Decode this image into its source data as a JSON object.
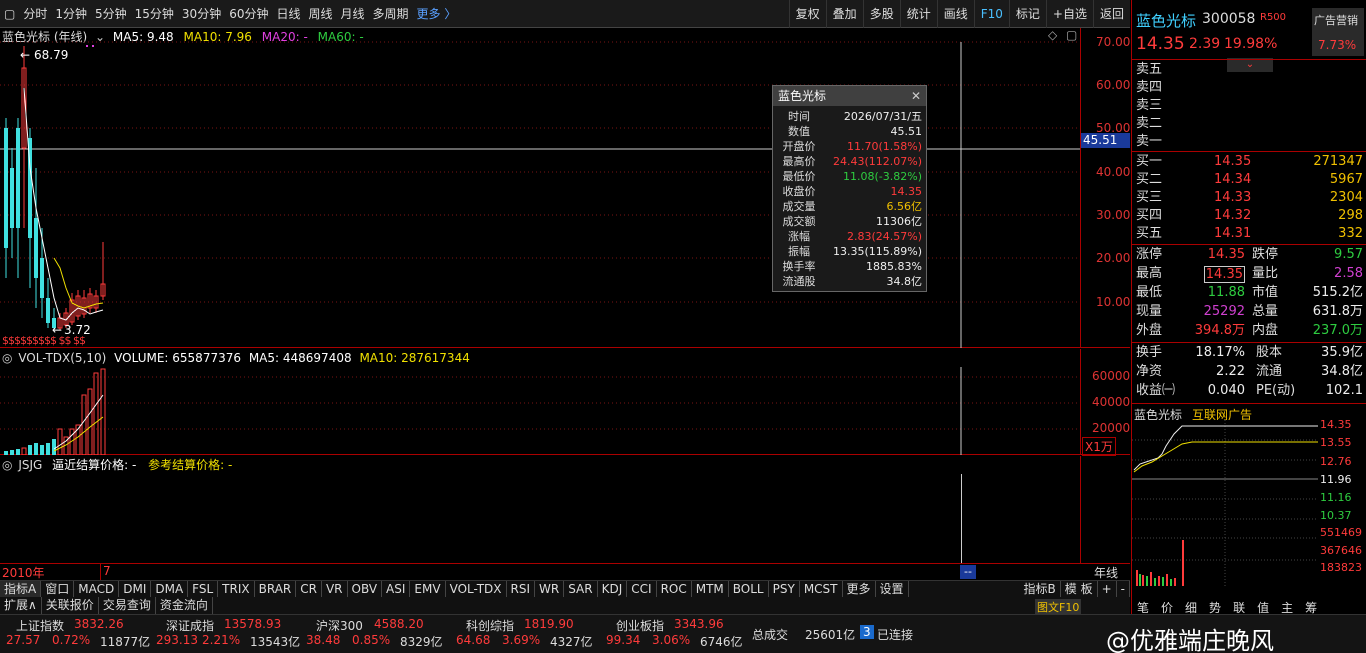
{
  "toolbar": {
    "periods": [
      "分时",
      "1分钟",
      "5分钟",
      "15分钟",
      "30分钟",
      "60分钟",
      "日线",
      "周线",
      "月线",
      "多周期"
    ],
    "more": "更多 〉",
    "right": [
      "复权",
      "叠加",
      "多股",
      "统计",
      "画线",
      "F10",
      "标记",
      "+自选",
      "返回"
    ]
  },
  "main": {
    "title": "蓝色光标 (年线)",
    "ma5": "MA5: 9.48",
    "ma10": "MA10: 7.96",
    "ma20": "MA20: -",
    "ma60": "MA60: -",
    "high_label": "68.79",
    "low_label": "3.72",
    "yticks": [
      "70.00",
      "60.00",
      "50.00",
      "40.00",
      "30.00",
      "20.00",
      "10.00"
    ],
    "cursor_value": "45.51",
    "dividend_marks": "$$$$$$$$$ $$ $$"
  },
  "tooltip": {
    "title": "蓝色光标",
    "close": "✕",
    "rows": [
      {
        "k": "时间",
        "v": "2026/07/31/五",
        "c": "white"
      },
      {
        "k": "数值",
        "v": "45.51",
        "c": "white"
      },
      {
        "k": "开盘价",
        "v": "11.70(1.58%)",
        "c": "red"
      },
      {
        "k": "最高价",
        "v": "24.43(112.07%)",
        "c": "red"
      },
      {
        "k": "最低价",
        "v": "11.08(-3.82%)",
        "c": "green"
      },
      {
        "k": "收盘价",
        "v": "14.35",
        "c": "red"
      },
      {
        "k": "成交量",
        "v": "6.56亿",
        "c": "yellow"
      },
      {
        "k": "成交额",
        "v": "11306亿",
        "c": "white"
      },
      {
        "k": "涨幅",
        "v": "2.83(24.57%)",
        "c": "red"
      },
      {
        "k": "振幅",
        "v": "13.35(115.89%)",
        "c": "white"
      },
      {
        "k": "换手率",
        "v": "1885.83%",
        "c": "white"
      },
      {
        "k": "流通股",
        "v": "34.8亿",
        "c": "white"
      }
    ]
  },
  "volume": {
    "label": "VOL-TDX(5,10)",
    "volume": "VOLUME: 655877376",
    "ma5": "MA5: 448697408",
    "ma10": "MA10: 287617344",
    "yticks": [
      "60000",
      "40000",
      "20000"
    ],
    "unit": "X1万"
  },
  "jsjg": {
    "label": "JSJG",
    "recent": "逼近结算价格: -",
    "ref": "参考结算价格: -"
  },
  "xaxis": {
    "start": "2010年",
    "mid": "7",
    "period": "年线",
    "cursor": "--"
  },
  "tabs": {
    "row1": [
      "指标A",
      "窗口",
      "MACD",
      "DMI",
      "DMA",
      "FSL",
      "TRIX",
      "BRAR",
      "CR",
      "VR",
      "OBV",
      "ASI",
      "EMV",
      "VOL-TDX",
      "RSI",
      "WR",
      "SAR",
      "KDJ",
      "CCI",
      "ROC",
      "MTM",
      "BOLL",
      "PSY",
      "MCST",
      "更多",
      "设置"
    ],
    "row1_right": [
      "指标B",
      "模 板",
      "+",
      "-"
    ],
    "row2": [
      "扩展∧",
      "关联报价",
      "交易查询",
      "资金流向"
    ]
  },
  "indices": [
    {
      "name": "上证指数",
      "val": "3832.26",
      "chg": "27.57",
      "pct": "0.72%",
      "amt": "11877亿"
    },
    {
      "name": "深证成指",
      "val": "13578.93",
      "chg": "293.13",
      "pct": "2.21%",
      "amt": "13543亿"
    },
    {
      "name": "沪深300",
      "val": "4588.20",
      "chg": "38.48",
      "pct": "0.85%",
      "amt": "8329亿"
    },
    {
      "name": "科创综指",
      "val": "1819.90",
      "chg": "64.68",
      "pct": "3.69%",
      "amt": "4327亿"
    },
    {
      "name": "创业板指",
      "val": "3343.96",
      "chg": "99.34",
      "pct": "3.06%",
      "amt": "6746亿"
    }
  ],
  "bottom": {
    "total_label": "总成交",
    "total": "25601亿",
    "conn_num": "3",
    "conn": "已连接",
    "f10": "图文F10",
    "watermark": "@优雅端庄晚风",
    "right_tabs": [
      "笔",
      "价",
      "细",
      "势",
      "联",
      "值",
      "主",
      "筹"
    ]
  },
  "stock": {
    "name": "蓝色光标",
    "code": "300058",
    "tag": "R500",
    "ad": "广告营销",
    "ad_pct": "7.73%",
    "price": "14.35",
    "chg": "2.39",
    "pct": "19.98%",
    "sells": [
      "卖五",
      "卖四",
      "卖三",
      "卖二",
      "卖一"
    ],
    "buys": [
      {
        "k": "买一",
        "p": "14.35",
        "v": "271347"
      },
      {
        "k": "买二",
        "p": "14.34",
        "v": "5967"
      },
      {
        "k": "买三",
        "p": "14.33",
        "v": "2304"
      },
      {
        "k": "买四",
        "p": "14.32",
        "v": "298"
      },
      {
        "k": "买五",
        "p": "14.31",
        "v": "332"
      }
    ],
    "stats": [
      {
        "k1": "涨停",
        "v1": "14.35",
        "c1": "red",
        "k2": "跌停",
        "v2": "9.57",
        "c2": "green"
      },
      {
        "k1": "最高",
        "v1": "14.35",
        "c1": "red",
        "k2": "量比",
        "v2": "2.58",
        "c2": "purple"
      },
      {
        "k1": "最低",
        "v1": "11.88",
        "c1": "green",
        "k2": "市值",
        "v2": "515.2亿",
        "c2": "white"
      },
      {
        "k1": "现量",
        "v1": "25292",
        "c1": "purple",
        "k2": "总量",
        "v2": "631.8万",
        "c2": "white"
      },
      {
        "k1": "外盘",
        "v1": "394.8万",
        "c1": "red",
        "k2": "内盘",
        "v2": "237.0万",
        "c2": "green"
      }
    ],
    "stats2": [
      {
        "k1": "换手",
        "v1": "18.17%",
        "k2": "股本",
        "v2": "35.9亿"
      },
      {
        "k1": "净资",
        "v1": "2.22",
        "k2": "流通",
        "v2": "34.8亿"
      },
      {
        "k1": "收益㈠",
        "v1": "0.040",
        "k2": "PE(动)",
        "v2": "102.1"
      }
    ],
    "mini_title": "蓝色光标",
    "mini_tag": "互联网广告",
    "mini_prices": [
      "14.35",
      "13.55",
      "12.76",
      "11.96",
      "11.16",
      "10.37"
    ],
    "mini_vols": [
      "551469",
      "367646",
      "183823"
    ]
  }
}
